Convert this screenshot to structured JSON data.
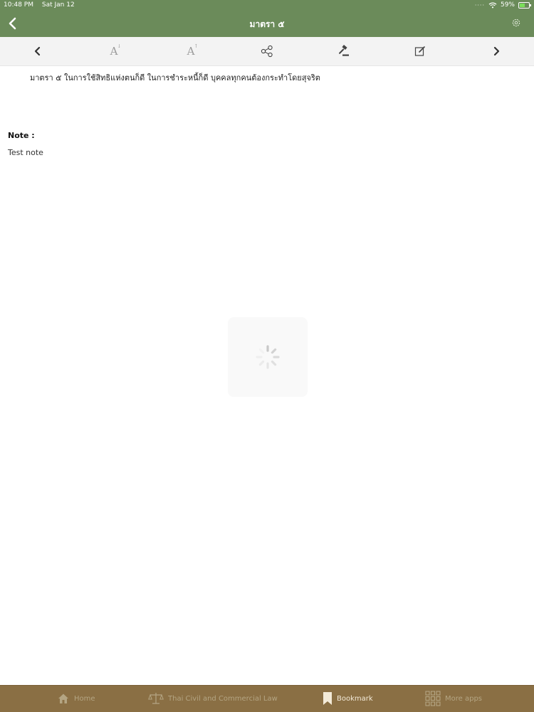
{
  "status_bar": {
    "time": "10:48 PM",
    "date": "Sat Jan 12",
    "battery_percent": "59%",
    "battery_level": 0.59
  },
  "nav": {
    "title": "มาตรา ๕",
    "back_icon": "chevron-left-icon",
    "settings_icon": "gear-icon"
  },
  "toolbar": {
    "items": [
      {
        "name": "previous-section-button",
        "icon": "chevron-left-icon"
      },
      {
        "name": "font-decrease-button",
        "icon": "font-size-icon",
        "glyph": "A"
      },
      {
        "name": "font-increase-button",
        "icon": "font-size-icon",
        "glyph": "A"
      },
      {
        "name": "share-button",
        "icon": "share-icon"
      },
      {
        "name": "judgment-button",
        "icon": "gavel-icon"
      },
      {
        "name": "edit-note-button",
        "icon": "edit-note-icon"
      },
      {
        "name": "next-section-button",
        "icon": "chevron-right-icon"
      }
    ]
  },
  "content": {
    "section_text": "มาตรา ๕ ในการใช้สิทธิแห่งตนก็ดี ในการชำระหนี้ก็ดี บุคคลทุกคนต้องกระทำโดยสุจริต",
    "note_label": "Note :",
    "note_text": "Test note"
  },
  "tab_bar": {
    "tabs": [
      {
        "label": "Home",
        "icon": "home-icon",
        "active": false
      },
      {
        "label": "Thai Civil and Commercial Law",
        "icon": "scales-icon",
        "active": false
      },
      {
        "label": "Bookmark",
        "icon": "bookmark-icon",
        "active": true
      },
      {
        "label": "More apps",
        "icon": "grid-icon",
        "active": false
      }
    ]
  },
  "colors": {
    "nav_green": "#6b8b5a",
    "toolbar_gray": "#f3f3f3",
    "tab_brown": "#8a6f44",
    "tab_active_text": "#f3ead8",
    "tab_inactive_text": "#b4a583"
  }
}
